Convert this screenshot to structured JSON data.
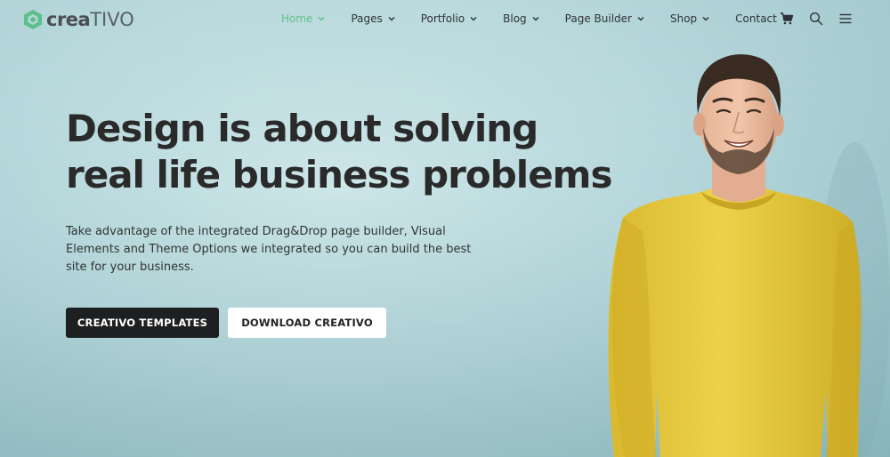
{
  "brand": {
    "name_bold": "crea",
    "name_light": "TIVO",
    "accent_color": "#5cc08a"
  },
  "nav": {
    "items": [
      {
        "label": "Home",
        "active": true,
        "has_dropdown": true
      },
      {
        "label": "Pages",
        "active": false,
        "has_dropdown": true
      },
      {
        "label": "Portfolio",
        "active": false,
        "has_dropdown": true
      },
      {
        "label": "Blog",
        "active": false,
        "has_dropdown": true
      },
      {
        "label": "Page Builder",
        "active": false,
        "has_dropdown": true
      },
      {
        "label": "Shop",
        "active": false,
        "has_dropdown": true
      },
      {
        "label": "Contact",
        "active": false,
        "has_dropdown": false
      }
    ],
    "icons": [
      "cart-icon",
      "search-icon",
      "hamburger-menu-icon"
    ]
  },
  "hero": {
    "headline_line1": "Design is about solving",
    "headline_line2": "real life business problems",
    "lead": "Take advantage of the integrated Drag&Drop page builder, Visual Elements and Theme Options we integrated so you can build the best site for your business.",
    "primary_button": "CREATIVO TEMPLATES",
    "secondary_button": "DOWNLOAD CREATIVO"
  },
  "colors": {
    "background": "#b3d6da",
    "text_dark": "#2a2a2a",
    "button_dark": "#1e1f21",
    "shirt": "#e3c63e"
  }
}
